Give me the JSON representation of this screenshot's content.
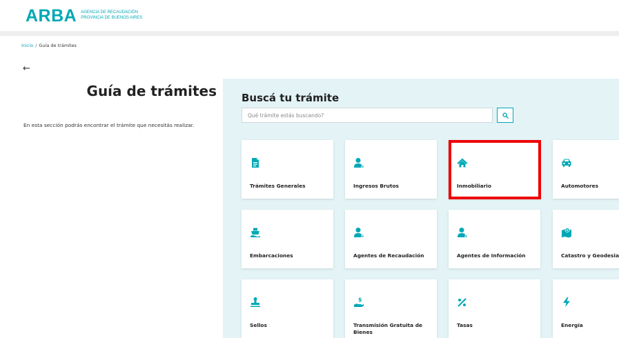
{
  "header": {
    "logo_text": "ARBA",
    "logo_sub_line1": "AGENCIA DE RECAUDACIÓN",
    "logo_sub_line2": "PROVINCIA DE BUENOS AIRES"
  },
  "breadcrumb": {
    "home": "Inicio",
    "separator": "/",
    "current": "Guía de trámites"
  },
  "back_arrow": "←",
  "page": {
    "title": "Guía de trámites",
    "description": "En esta sección podrás encontrar el trámite que necesitás realizar."
  },
  "search": {
    "title": "Buscá tu trámite",
    "placeholder": "Qué trámite estás buscando?"
  },
  "cards": [
    {
      "label": "Trámites Generales",
      "icon": "document-icon"
    },
    {
      "label": "Ingresos Brutos",
      "icon": "person-icon"
    },
    {
      "label": "Inmobiliario",
      "icon": "house-icon"
    },
    {
      "label": "Automotores",
      "icon": "car-icon"
    },
    {
      "label": "Embarcaciones",
      "icon": "ship-icon"
    },
    {
      "label": "Agentes de Recaudación",
      "icon": "person-icon"
    },
    {
      "label": "Agentes de Información",
      "icon": "person-icon"
    },
    {
      "label": "Catastro y Geodesia",
      "icon": "map-icon"
    },
    {
      "label": "Sellos",
      "icon": "stamp-icon"
    },
    {
      "label": "Transmisión Gratuita de Bienes",
      "icon": "hand-money-icon"
    },
    {
      "label": "Tasas",
      "icon": "percent-icon"
    },
    {
      "label": "Energía",
      "icon": "lightning-icon"
    }
  ],
  "colors": {
    "accent": "#00a8b5",
    "panel_bg": "#e3f3f6",
    "highlight": "#ee0000"
  }
}
